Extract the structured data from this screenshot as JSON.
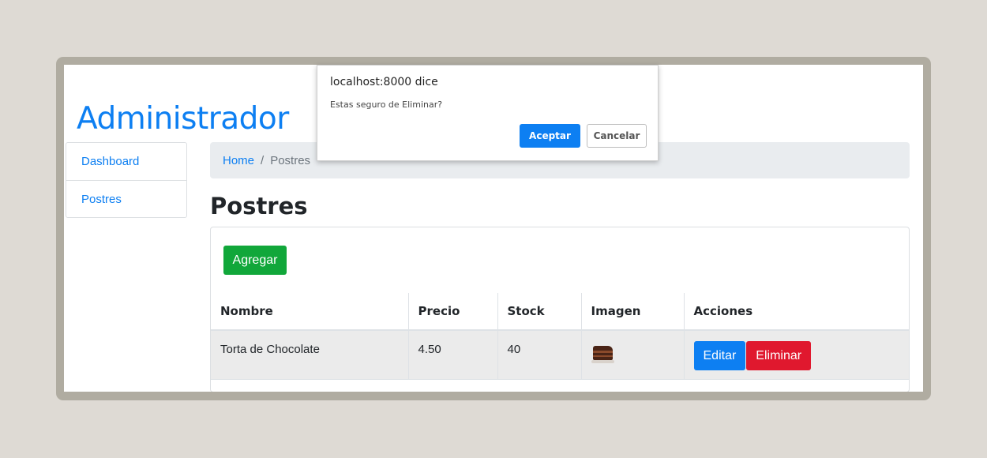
{
  "app": {
    "title": "Administrador"
  },
  "sidebar": {
    "items": [
      {
        "label": "Dashboard"
      },
      {
        "label": "Postres"
      }
    ]
  },
  "breadcrumb": {
    "home": "Home",
    "separator": "/",
    "current": "Postres"
  },
  "page": {
    "title": "Postres",
    "add_label": "Agregar"
  },
  "table": {
    "headers": [
      "Nombre",
      "Precio",
      "Stock",
      "Imagen",
      "Acciones"
    ],
    "rows": [
      {
        "nombre": "Torta de Chocolate",
        "precio": "4.50",
        "stock": "40",
        "imagen_icon": "chocolate-cake-image",
        "edit_label": "Editar",
        "delete_label": "Eliminar"
      }
    ]
  },
  "dialog": {
    "origin": "localhost:8000 dice",
    "message": "Estas seguro de Eliminar?",
    "ok_label": "Aceptar",
    "cancel_label": "Cancelar"
  },
  "colors": {
    "primary": "#0d7ff2",
    "success": "#11a73a",
    "danger": "#e0182e",
    "breadcrumb_bg": "#e9ecef",
    "row_bg": "#ebebeb",
    "page_bg": "#dedad4",
    "frame": "#b0aca1"
  }
}
